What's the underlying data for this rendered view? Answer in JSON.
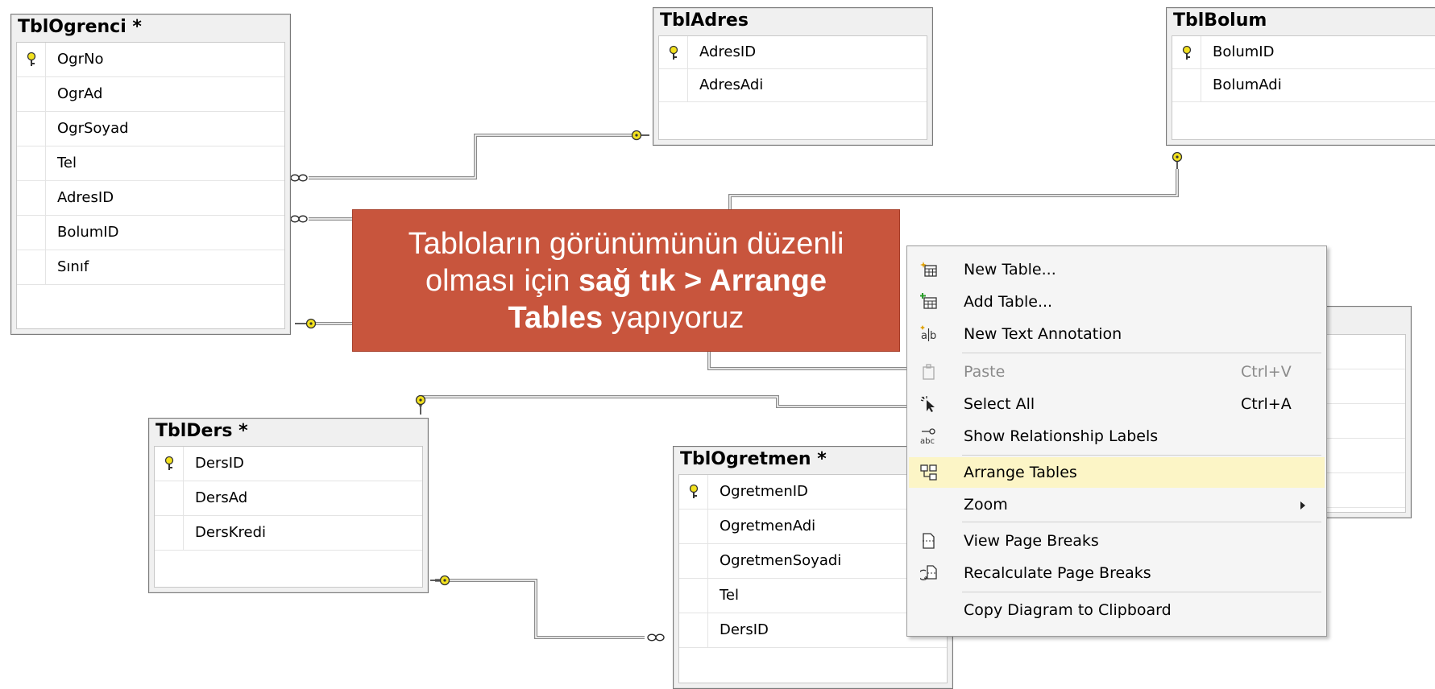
{
  "tables": [
    {
      "id": "ogrenci",
      "title": "TblOgrenci *",
      "columns": [
        "OgrNo",
        "OgrAd",
        "OgrSoyad",
        "Tel",
        "AdresID",
        "BolumID",
        "Sınıf"
      ]
    },
    {
      "id": "adres",
      "title": "TblAdres",
      "columns": [
        "AdresID",
        "AdresAdi"
      ]
    },
    {
      "id": "bolum",
      "title": "TblBolum",
      "columns": [
        "BolumID",
        "BolumAdi"
      ]
    },
    {
      "id": "ders",
      "title": "TblDers *",
      "columns": [
        "DersID",
        "DersAd",
        "DersKredi"
      ]
    },
    {
      "id": "ogretmen",
      "title": "TblOgretmen *",
      "columns": [
        "OgretmenID",
        "OgretmenAdi",
        "OgretmenSoyadi",
        "Tel",
        "DersID"
      ]
    }
  ],
  "callout": {
    "line1": "Tabloların görünümünün düzenli",
    "line2_a": "olması için ",
    "line2_b": "sağ tık > Arrange",
    "line3_a": "Tables",
    "line3_b": " yapıyoruz"
  },
  "menu": {
    "items": [
      {
        "label": "New Table...",
        "icon": "new-table-icon"
      },
      {
        "label": "Add Table...",
        "icon": "add-table-icon"
      },
      {
        "label": "New Text Annotation",
        "icon": "text-annotation-icon"
      },
      {
        "label": "Paste",
        "shortcut": "Ctrl+V",
        "icon": "paste-icon",
        "disabled": true
      },
      {
        "label": "Select All",
        "shortcut": "Ctrl+A",
        "icon": "select-all-icon"
      },
      {
        "label": "Show Relationship Labels",
        "icon": "relationship-labels-icon"
      },
      {
        "label": "Arrange Tables",
        "icon": "arrange-tables-icon",
        "highlighted": true
      },
      {
        "label": "Zoom",
        "icon": "",
        "submenu": true
      },
      {
        "label": "View Page Breaks",
        "icon": "page-breaks-icon"
      },
      {
        "label": "Recalculate Page Breaks",
        "icon": "recalculate-icon"
      },
      {
        "label": "Copy Diagram to Clipboard",
        "icon": ""
      }
    ]
  },
  "colors": {
    "callout": "#c8553d",
    "highlight": "#fcf5c6",
    "key": "#e8d11a",
    "line": "#7a7a7a"
  }
}
